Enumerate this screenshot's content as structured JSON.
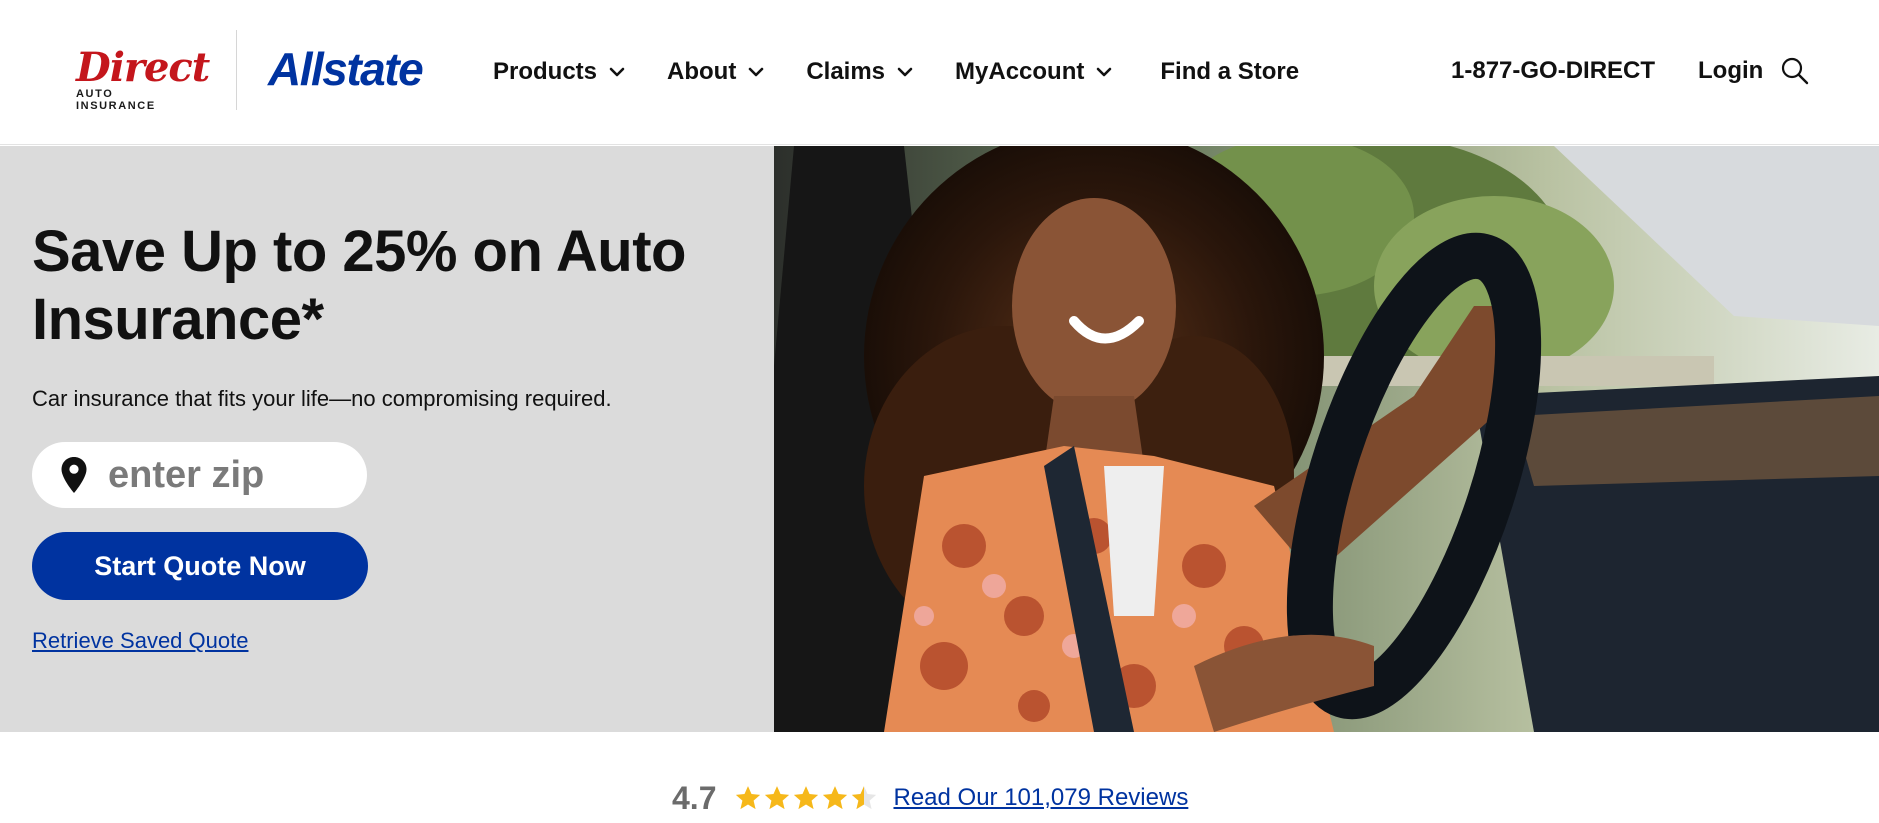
{
  "header": {
    "logo_direct_main": "Direct",
    "logo_direct_sub": "AUTO INSURANCE",
    "logo_allstate": "Allstate",
    "nav": [
      {
        "label": "Products",
        "has_dropdown": true
      },
      {
        "label": "About",
        "has_dropdown": true
      },
      {
        "label": "Claims",
        "has_dropdown": true
      },
      {
        "label": "MyAccount",
        "has_dropdown": true
      },
      {
        "label": "Find a Store",
        "has_dropdown": false
      }
    ],
    "phone": "1-877-GO-DIRECT",
    "login": "Login",
    "search_icon": "search-icon"
  },
  "hero": {
    "title": "Save Up to 25% on Auto Insurance*",
    "subtitle": "Car insurance that fits your life—no compromising required.",
    "zip_placeholder": "enter zip",
    "zip_value": "",
    "cta_label": "Start Quote Now",
    "retrieve_label": "Retrieve Saved Quote",
    "image_alt": "Smiling woman with curly hair driving a car"
  },
  "reviews": {
    "rating": "4.7",
    "stars_filled": 4.5,
    "stars_total": 5,
    "link_label": "Read Our 101,079 Reviews"
  },
  "colors": {
    "brand_blue": "#0033a0",
    "brand_red": "#c4161c",
    "hero_bg": "#dbdbdb",
    "star": "#f6b81a"
  }
}
